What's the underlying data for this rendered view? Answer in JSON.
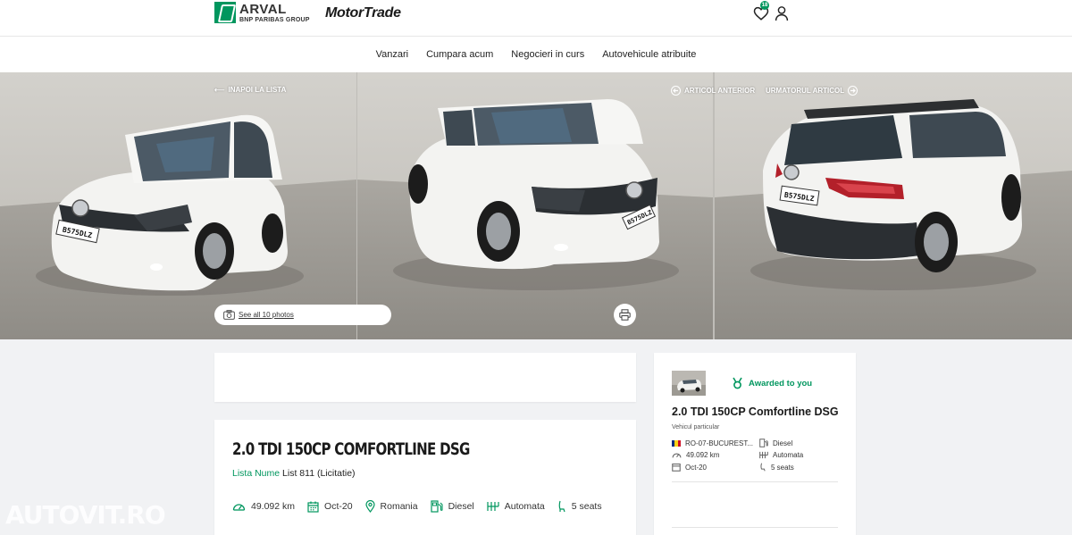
{
  "header": {
    "brand_name": "ARVAL",
    "brand_sub": "BNP PARIBAS GROUP",
    "partner_logo": "MotorTrade",
    "favorites_count": "18",
    "icons": [
      "heart-icon",
      "user-icon"
    ]
  },
  "nav": {
    "items": [
      {
        "label": "Vanzari"
      },
      {
        "label": "Cumpara acum"
      },
      {
        "label": "Negocieri in curs"
      },
      {
        "label": "Autovehicule atribuite"
      }
    ]
  },
  "gallery": {
    "back_label": "INAPOI LA LISTA",
    "prev_label": "ARTICOL ANTERIOR",
    "next_label": "URMATORUL ARTICOL",
    "see_photos_label": "See all 10 photos",
    "plate": "B 575 DLZ"
  },
  "listing": {
    "title": "2.0 TDI 150CP COMFORTLINE DSG",
    "list_label": "Lista Nume",
    "list_value": "List 811 (Licitatie)",
    "specs": [
      {
        "icon": "speedometer-icon",
        "value": "49.092 km"
      },
      {
        "icon": "calendar-icon",
        "value": "Oct-20"
      },
      {
        "icon": "location-pin-icon",
        "value": "Romania"
      },
      {
        "icon": "fuel-pump-icon",
        "value": "Diesel"
      },
      {
        "icon": "gearbox-icon",
        "value": "Automata"
      },
      {
        "icon": "seat-icon",
        "value": "5 seats"
      }
    ]
  },
  "sidebar": {
    "status": "Awarded to you",
    "title": "2.0 TDI 150CP Comfortline DSG",
    "subtitle": "Vehicul particular",
    "specs": [
      {
        "icon": "romania-flag-icon",
        "value": "RO-07-BUCUREST..."
      },
      {
        "icon": "fuel-pump-icon",
        "value": "Diesel"
      },
      {
        "icon": "speedometer-icon",
        "value": "49.092 km"
      },
      {
        "icon": "gearbox-icon",
        "value": "Automata"
      },
      {
        "icon": "calendar-icon",
        "value": "Oct-20"
      },
      {
        "icon": "seat-icon",
        "value": "5 seats"
      }
    ]
  },
  "watermark": "AUTOVIT.RO",
  "colors": {
    "accent": "#00965e",
    "page_bg": "#f1f2f4"
  }
}
